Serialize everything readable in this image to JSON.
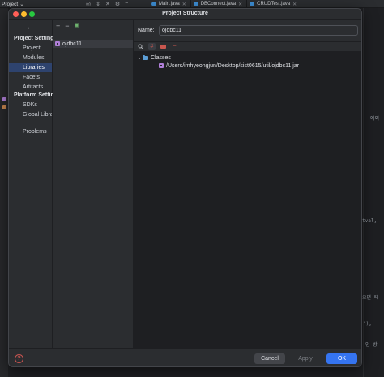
{
  "ide": {
    "project_label": "Project",
    "tabs": [
      {
        "label": "Main.java"
      },
      {
        "label": "DBConnect.java"
      },
      {
        "label": "CRUDTest.java"
      }
    ],
    "snippets": [
      "예외",
      "tval,",
      "오면 페",
      "\");",
      "인 방"
    ]
  },
  "dialog": {
    "title": "Project Structure",
    "nav": {
      "project_settings_header": "Project Settings",
      "project_settings_items": [
        "Project",
        "Modules",
        "Libraries",
        "Facets",
        "Artifacts"
      ],
      "platform_settings_header": "Platform Settings",
      "platform_settings_items": [
        "SDKs",
        "Global Libraries"
      ],
      "problems": "Problems",
      "selected": "Libraries"
    },
    "library_list": {
      "items": [
        "ojdbc11"
      ]
    },
    "detail": {
      "name_label": "Name:",
      "name_value": "ojdbc11",
      "tree": {
        "classes_label": "Classes",
        "jar_path": "/Users/imhyeongjun/Desktop/sist0615/util/ojdbc11.jar"
      }
    },
    "footer": {
      "help": "?",
      "cancel": "Cancel",
      "apply": "Apply",
      "ok": "OK"
    }
  },
  "colors": {
    "accent": "#3574f0",
    "selection": "#2e436e",
    "panel": "#2b2d30",
    "background": "#1e1f22",
    "error": "#c75450"
  }
}
